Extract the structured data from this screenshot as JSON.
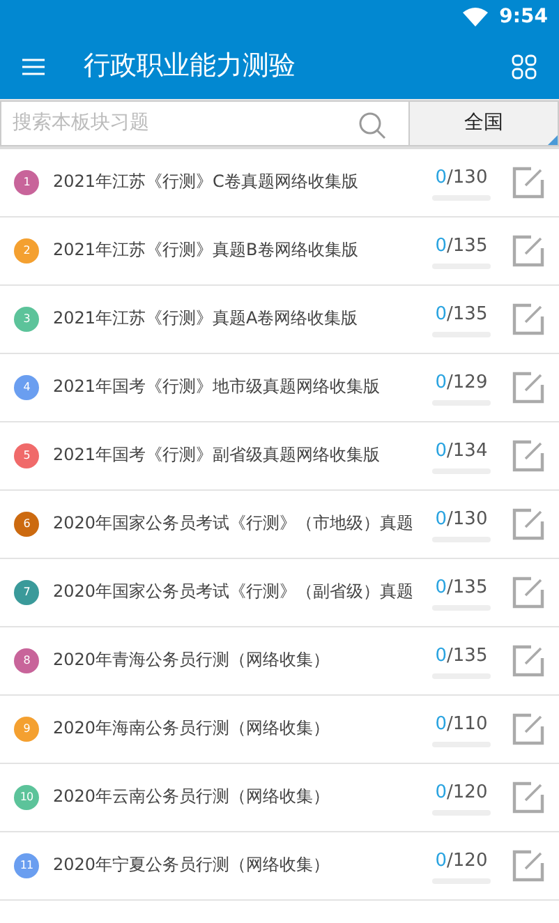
{
  "status_bar": {
    "time": "9:54"
  },
  "app_bar": {
    "title": "行政职业能力测验"
  },
  "search": {
    "placeholder": "搜索本板块习题",
    "region": "全国"
  },
  "items": [
    {
      "number": "1",
      "color": "#c8649a",
      "title": "2021年江苏《行测》C卷真题网络收集版",
      "done": "0",
      "total": "/130",
      "level": 0
    },
    {
      "number": "2",
      "color": "#f4a030",
      "title": "2021年江苏《行测》真题B卷网络收集版",
      "done": "0",
      "total": "/135",
      "level": 0
    },
    {
      "number": "3",
      "color": "#5cc39a",
      "title": "2021年江苏《行测》真题A卷网络收集版",
      "done": "0",
      "total": "/135",
      "level": 0
    },
    {
      "number": "4",
      "color": "#6a9ef0",
      "title": "2021年国考《行测》地市级真题网络收集版",
      "done": "0",
      "total": "/129",
      "level": 0
    },
    {
      "number": "5",
      "color": "#f06a6a",
      "title": "2021年国考《行测》副省级真题网络收集版",
      "done": "0",
      "total": "/134",
      "level": 0
    },
    {
      "number": "6",
      "color": "#cc6a10",
      "title": "2020年国家公务员考试《行测》（市地级）真题",
      "done": "0",
      "total": "/130",
      "level": 0
    },
    {
      "number": "7",
      "color": "#3a9a9a",
      "title": "2020年国家公务员考试《行测》（副省级）真题",
      "done": "0",
      "total": "/135",
      "level": 0
    },
    {
      "number": "8",
      "color": "#c8649a",
      "title": "2020年青海公务员行测（网络收集）",
      "done": "0",
      "total": "/135",
      "level": 0
    },
    {
      "number": "9",
      "color": "#f4a030",
      "title": "2020年海南公务员行测（网络收集）",
      "done": "0",
      "total": "/110",
      "level": 0
    },
    {
      "number": "10",
      "color": "#5cc39a",
      "title": "2020年云南公务员行测（网络收集）",
      "done": "0",
      "total": "/120",
      "level": 0
    },
    {
      "number": "11",
      "color": "#6a9ef0",
      "title": "2020年宁夏公务员行测（网络收集）",
      "done": "0",
      "total": "/120",
      "level": 0
    }
  ]
}
